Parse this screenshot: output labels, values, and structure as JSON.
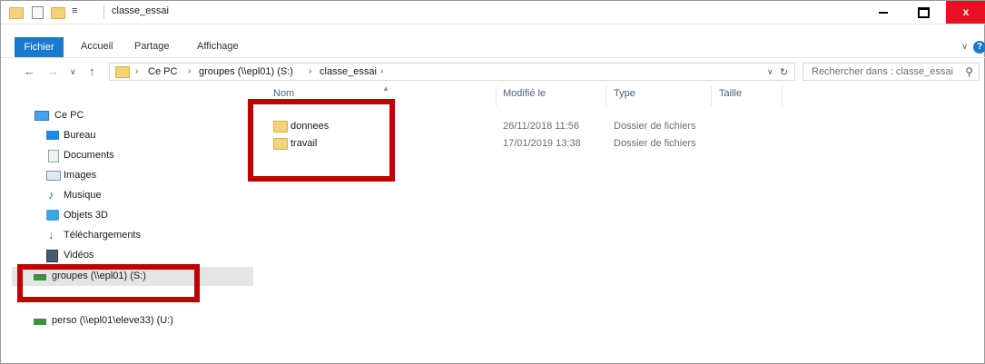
{
  "window": {
    "title": "classe_essai",
    "close_glyph": "x"
  },
  "ribbon": {
    "tabs": [
      "Fichier",
      "Accueil",
      "Partage",
      "Affichage"
    ],
    "expand_glyph": "∨",
    "help_glyph": "?"
  },
  "address": {
    "crumbs": [
      "Ce PC",
      "groupes (\\\\epl01) (S:)",
      "classe_essai"
    ],
    "dropdown_glyph": "∨",
    "refresh_glyph": "↻"
  },
  "search": {
    "placeholder": "Rechercher dans : classe_essai",
    "icon": "search-icon"
  },
  "sidebar": {
    "items": [
      {
        "label": "Ce PC",
        "icon": "computer-icon"
      },
      {
        "label": "Bureau",
        "icon": "desktop-icon"
      },
      {
        "label": "Documents",
        "icon": "documents-icon"
      },
      {
        "label": "Images",
        "icon": "images-icon"
      },
      {
        "label": "Musique",
        "icon": "music-icon"
      },
      {
        "label": "Objets 3D",
        "icon": "objects3d-icon"
      },
      {
        "label": "Téléchargements",
        "icon": "downloads-icon"
      },
      {
        "label": "Vidéos",
        "icon": "videos-icon"
      },
      {
        "label": "groupes (\\\\epl01) (S:)",
        "icon": "network-drive-icon"
      },
      {
        "label": "perso (\\\\epl01\\eleve33) (U:)",
        "icon": "network-drive-icon"
      }
    ]
  },
  "columns": {
    "name": "Nom",
    "modified": "Modifié le",
    "type": "Type",
    "size": "Taille"
  },
  "files": [
    {
      "name": "donnees",
      "modified": "26/11/2018 11:56",
      "type": "Dossier de fichiers"
    },
    {
      "name": "travail",
      "modified": "17/01/2019 13:38",
      "type": "Dossier de fichiers"
    }
  ],
  "colors": {
    "accent": "#1979ca",
    "highlight": "#c00000",
    "close": "#e81123"
  }
}
